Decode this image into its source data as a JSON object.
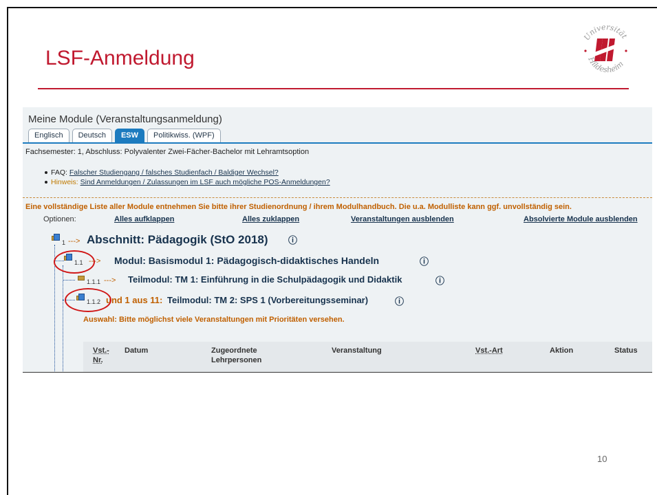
{
  "slide": {
    "title": "LSF-Anmeldung",
    "page_number": "10",
    "logo": {
      "name": "Universität Hildesheim",
      "colors": [
        "#c0192f",
        "#8b8b8b"
      ]
    }
  },
  "module_view": {
    "section_title": "Meine Module (Veranstaltungsanmeldung)",
    "tabs": [
      {
        "label": "Englisch",
        "active": false
      },
      {
        "label": "Deutsch",
        "active": false
      },
      {
        "label": "ESW",
        "active": true
      },
      {
        "label": "Politikwiss. (WPF)",
        "active": false
      }
    ],
    "semester_info": "Fachsemester: 1, Abschluss: Polyvalenter Zwei-Fächer-Bachelor mit Lehramtsoption",
    "faq": {
      "label": "FAQ:",
      "link": "Falscher Studiengang / falsches Studienfach / Baldiger Wechsel?"
    },
    "hinweis": {
      "label": "Hinweis:",
      "link": "Sind Anmeldungen / Zulassungen im LSF auch mögliche POS-Anmeldungen?"
    },
    "notice": "Eine vollständige Liste aller Module entnehmen Sie bitte ihrer Studienordnung / ihrem Modulhandbuch. Die u.a. Modulliste kann ggf. unvollständig sein.",
    "options": {
      "label": "Optionen:",
      "items": [
        "Alles aufklappen",
        "Alles zuklappen",
        "Veranstaltungen ausblenden",
        "Absolvierte Module ausblenden"
      ]
    },
    "tree": {
      "abschnitt": {
        "num": "1",
        "arrow": "--->",
        "title": "Abschnitt:  Pädagogik (StO 2018)"
      },
      "modul": {
        "num": "1.1",
        "arrow": "--->",
        "title": "Modul:  Basismodul 1: Pädagogisch-didaktisches Handeln"
      },
      "teilmodul1": {
        "num": "1.1.1",
        "arrow": "--->",
        "title": "Teilmodul:  TM 1: Einführung in die Schulpädagogik und Didaktik"
      },
      "teilmodul2": {
        "num": "1.1.2",
        "prefix": "und 1 aus 11:",
        "title": "Teilmodul:  TM 2: SPS 1 (Vorbereitungsseminar)"
      },
      "info_symbol": "ⓘ"
    },
    "auswahl": "Auswahl: Bitte möglichst viele Veranstaltungen mit Prioritäten versehen.",
    "table_headers": [
      "Vst.-Nr.",
      "Datum",
      "Zugeordnete Lehrpersonen",
      "Veranstaltung",
      "Vst.-Art",
      "Aktion",
      "Status"
    ],
    "highlight_color": "#d01818"
  }
}
